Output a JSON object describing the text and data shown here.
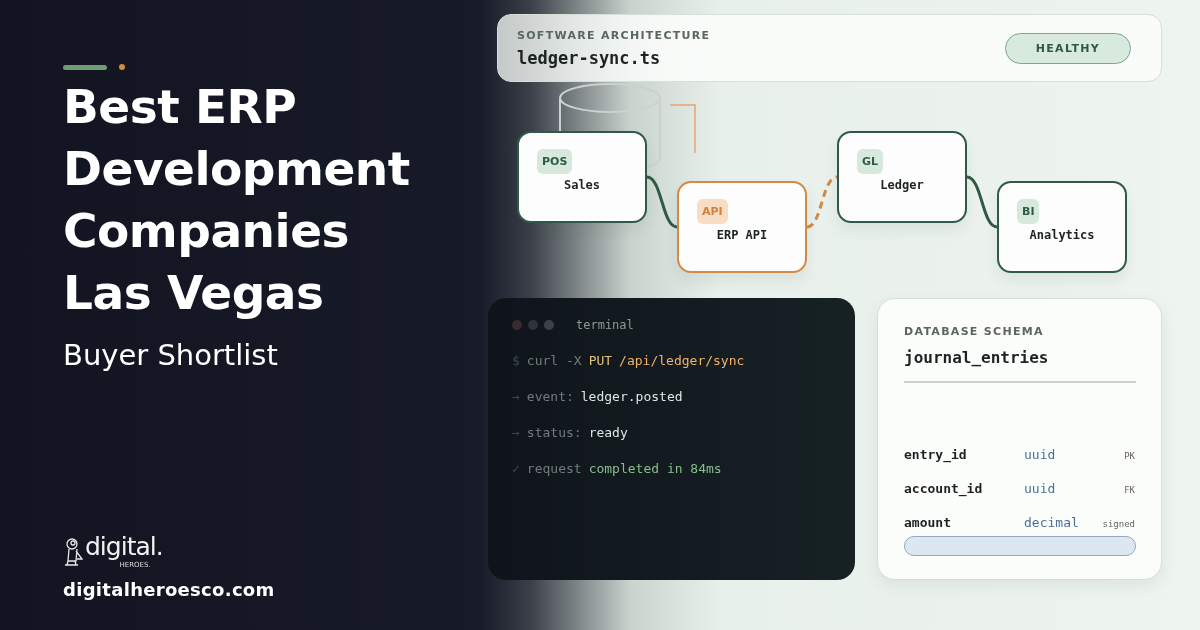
{
  "headline": {
    "lines": [
      "Best ERP",
      "Development",
      "Companies",
      "Las Vegas"
    ],
    "subtitle": "Buyer Shortlist"
  },
  "brand": {
    "logo_word": "digital.",
    "logo_sub": "HEROES.",
    "website": "digitalheroesco.com"
  },
  "header": {
    "eyebrow": "SOFTWARE ARCHITECTURE",
    "file": "ledger-sync.ts",
    "status": "HEALTHY"
  },
  "nodes": [
    {
      "badge": "POS",
      "label": "Sales",
      "kind": "green"
    },
    {
      "badge": "API",
      "label": "ERP API",
      "kind": "orange"
    },
    {
      "badge": "GL",
      "label": "Ledger",
      "kind": "green"
    },
    {
      "badge": "BI",
      "label": "Analytics",
      "kind": "green"
    }
  ],
  "links": [
    {
      "kind": "solid"
    },
    {
      "kind": "dashed"
    },
    {
      "kind": "solid"
    }
  ],
  "terminal": {
    "title": "terminal",
    "lines": [
      {
        "prompt": "$",
        "segments": [
          {
            "text": "curl -X",
            "kind": "muted"
          },
          {
            "text": "PUT",
            "kind": "method"
          },
          {
            "text": "/api/ledger/sync",
            "kind": "path"
          }
        ]
      },
      {
        "prompt": "→",
        "segments": [
          {
            "text": "event:",
            "kind": "muted"
          },
          {
            "text": "ledger.posted",
            "kind": "value"
          }
        ]
      },
      {
        "prompt": "→",
        "segments": [
          {
            "text": "status:",
            "kind": "muted"
          },
          {
            "text": "ready",
            "kind": "value"
          }
        ]
      },
      {
        "prompt": "✓",
        "segments": [
          {
            "text": "request",
            "kind": "muted"
          },
          {
            "text": "completed in 84ms",
            "kind": "success"
          }
        ]
      }
    ]
  },
  "schema": {
    "eyebrow": "DATABASE SCHEMA",
    "table": "journal_entries",
    "fields": [
      {
        "name": "entry_id",
        "type": "uuid",
        "tag": "PK"
      },
      {
        "name": "account_id",
        "type": "uuid",
        "tag": "FK"
      },
      {
        "name": "amount",
        "type": "decimal",
        "tag": "signed"
      }
    ]
  }
}
